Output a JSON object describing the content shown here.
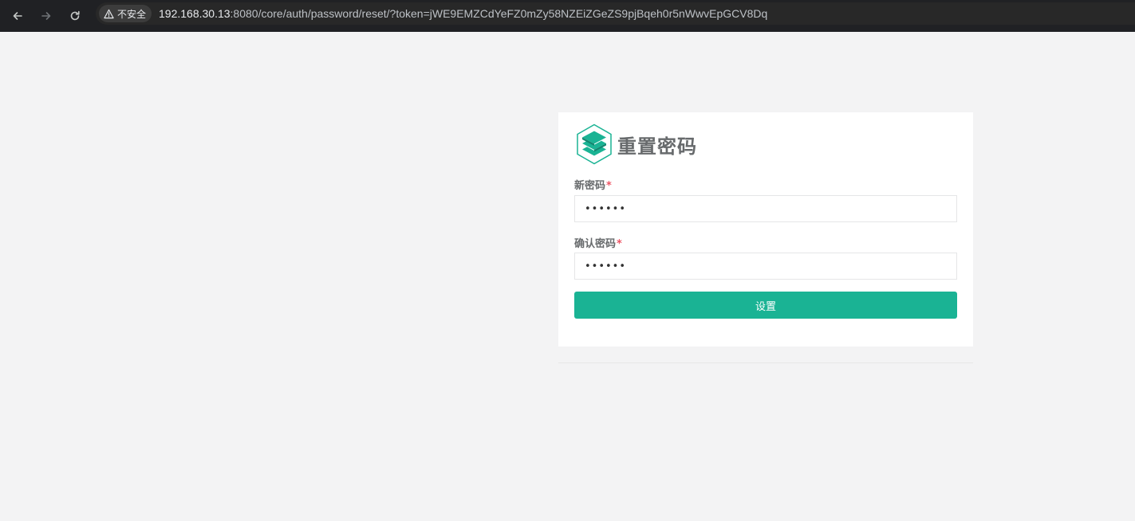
{
  "browser": {
    "security_label": "不安全",
    "url_host": "192.168.30.13",
    "url_rest": ":8080/core/auth/password/reset/?token=jWE9EMZCdYeFZ0mZy58NZEiZGeZS9pjBqeh0r5nWwvEpGCV8Dq"
  },
  "form": {
    "title": "重置密码",
    "new_password_label": "新密码",
    "confirm_password_label": "确认密码",
    "required_mark": "*",
    "new_password_value": "••••••",
    "confirm_password_value": "••••••",
    "submit_label": "设置"
  },
  "colors": {
    "accent": "#1ab394",
    "required": "#ed5565",
    "page_bg": "#f3f3f4",
    "chrome_bg": "#202124"
  }
}
